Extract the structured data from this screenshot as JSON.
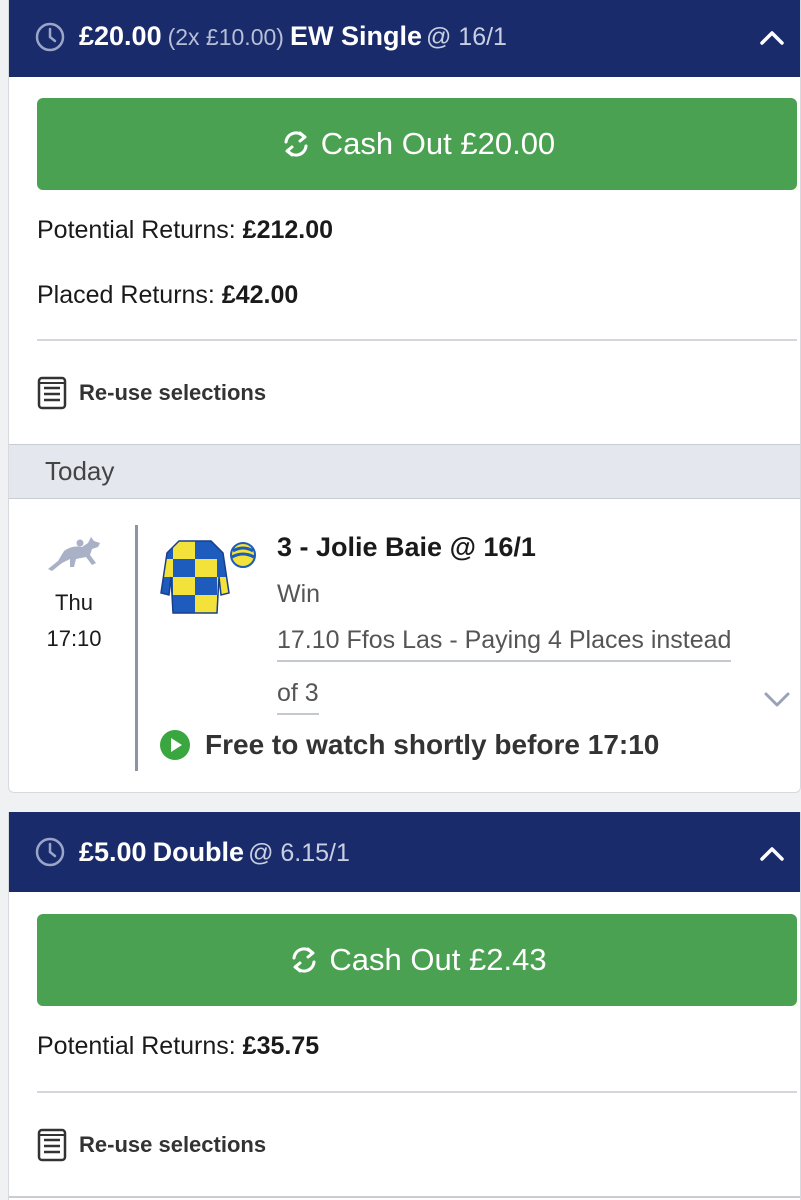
{
  "bet1": {
    "stake": "£20.00",
    "breakdown": "(2x £10.00)",
    "bet_type": "EW Single",
    "odds": "@ 16/1",
    "cashout_label": "Cash Out £20.00",
    "potential_label": "Potential Returns:",
    "potential_value": "£212.00",
    "placed_label": "Placed Returns:",
    "placed_value": "£42.00",
    "reuse_label": "Re-use selections",
    "day": "Today",
    "event_day": "Thu",
    "event_time": "17:10",
    "selection": "3 - Jolie Baie @ 16/1",
    "market": "Win",
    "event_line1": "17.10 Ffos Las - Paying 4 Places instead",
    "event_line2": "of 3",
    "watch_text": "Free to watch shortly before 17:10"
  },
  "bet2": {
    "stake": "£5.00",
    "bet_type": "Double",
    "odds": "@ 6.15/1",
    "cashout_label": "Cash Out £2.43",
    "potential_label": "Potential Returns:",
    "potential_value": "£35.75",
    "reuse_label": "Re-use selections"
  },
  "icons": {
    "clock": "clock-icon",
    "chevron_up": "chevron-up-icon",
    "cashout": "cashout-arrows-icon",
    "reuse": "document-list-icon",
    "horse": "horse-racing-icon",
    "silks": "jockey-silks-icon",
    "play": "play-icon",
    "expand": "chevron-down-icon"
  },
  "colors": {
    "header_bg": "#1a2b6b",
    "cashout_green": "#4ba152",
    "watch_green": "#3aa63f"
  }
}
